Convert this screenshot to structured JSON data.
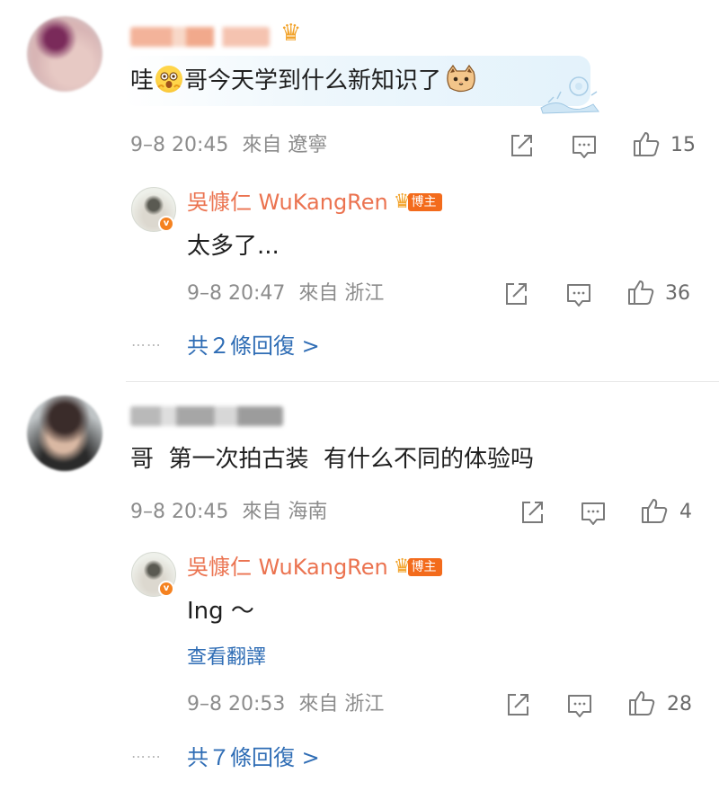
{
  "comments": [
    {
      "text_before": "哇",
      "text_after": "哥今天学到什么新知识了",
      "time": "9–8 20:45",
      "source": "來自 遼寧",
      "likes": "15",
      "reply": {
        "author": "吳慷仁 WuKangRen",
        "badge": "博主",
        "text": "太多了...",
        "time": "9–8 20:47",
        "source": "來自 浙江",
        "likes": "36"
      },
      "more": "共２條回復 >"
    },
    {
      "text": "哥  第一次拍古装  有什么不同的体验吗",
      "time": "9–8 20:45",
      "source": "來自 海南",
      "likes": "4",
      "reply": {
        "author": "吳慷仁 WuKangRen",
        "badge": "博主",
        "text": "Ing ～",
        "translate": "查看翻譯",
        "time": "9–8 20:53",
        "source": "來自 浙江",
        "likes": "28"
      },
      "more": "共７條回復 >"
    }
  ],
  "icons": {
    "share": "share-icon",
    "comment": "comment-icon",
    "like": "like-icon"
  },
  "colors": {
    "author": "#eb7350",
    "link": "#2f6db5",
    "badge": "#f36b1c"
  }
}
